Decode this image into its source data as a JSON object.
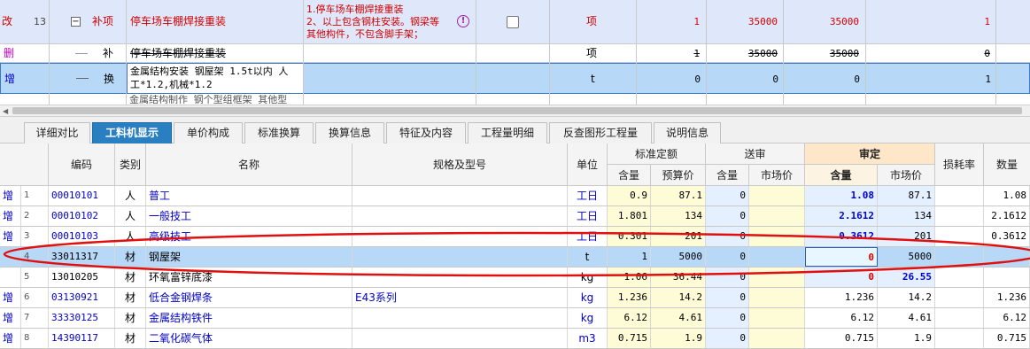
{
  "top_rows": [
    {
      "tag": "改",
      "num": "13",
      "toggle": "−",
      "kind": "补项",
      "name": "停车场车棚焊接重装",
      "feature_line1": "1.停车场车棚焊接重装",
      "feature_line2": "2、以上包含钢柱安装。钢梁等",
      "feature_line3": "其他构件，不包含脚手架；",
      "unit": "项",
      "qty": "1",
      "price": "35000",
      "price2": "35000",
      "last": "1"
    },
    {
      "tag": "删",
      "kind": "补",
      "name": "停车场车棚焊接重装",
      "unit": "项",
      "qty": "1",
      "price": "35000",
      "price2": "35000",
      "last": "0"
    },
    {
      "tag": "增",
      "kind": "换",
      "name_line1": "金属结构安装 钢屋架 1.5t以内  人",
      "name_line2": "工*1.2,机械*1.2",
      "unit": "t",
      "qty": "0",
      "price": "0",
      "price2": "0",
      "last": "1"
    },
    {
      "partial": "金属结构制作 钢个型组框架 其他型"
    }
  ],
  "tabs": [
    "详细对比",
    "工料机显示",
    "单价构成",
    "标准换算",
    "换算信息",
    "特征及内容",
    "工程量明细",
    "反查图形工程量",
    "说明信息"
  ],
  "active_tab": "工料机显示",
  "headers": {
    "code": "编码",
    "type": "类别",
    "name": "名称",
    "spec": "规格及型号",
    "unit": "单位",
    "std": "标准定额",
    "std_qty": "含量",
    "std_price": "预算价",
    "sub": "送审",
    "sub_qty": "含量",
    "sub_price": "市场价",
    "aud": "审定",
    "aud_qty": "含量",
    "aud_price": "市场价",
    "loss": "损耗率",
    "count": "数量"
  },
  "rows": [
    {
      "tag": "增",
      "n": "1",
      "code": "00010101",
      "type": "人",
      "name": "普工",
      "spec": "",
      "unit": "工日",
      "std_qty": "0.9",
      "std_price": "87.1",
      "sub_qty": "0",
      "sub_price": "",
      "aud_qty": "1.08",
      "aud_price": "87.1",
      "count": "1.08"
    },
    {
      "tag": "增",
      "n": "2",
      "code": "00010102",
      "type": "人",
      "name": "一般技工",
      "spec": "",
      "unit": "工日",
      "std_qty": "1.801",
      "std_price": "134",
      "sub_qty": "0",
      "sub_price": "",
      "aud_qty": "2.1612",
      "aud_price": "134",
      "count": "2.1612"
    },
    {
      "tag": "增",
      "n": "3",
      "code": "00010103",
      "type": "人",
      "name": "高级技工",
      "spec": "",
      "unit": "工日",
      "std_qty": "0.301",
      "std_price": "201",
      "sub_qty": "0",
      "sub_price": "",
      "aud_qty": "0.3612",
      "aud_price": "201",
      "count": "0.3612"
    },
    {
      "tag": "",
      "n": "4",
      "code": "33011317",
      "type": "材",
      "name": "钢屋架",
      "spec": "",
      "unit": "t",
      "std_qty": "1",
      "std_price": "5000",
      "sub_qty": "0",
      "sub_price": "",
      "aud_qty": "0",
      "aud_price": "5000",
      "count": ""
    },
    {
      "tag": "",
      "n": "5",
      "code": "13010205",
      "type": "材",
      "name": "环氧富锌底漆",
      "spec": "",
      "unit": "kg",
      "std_qty": "1.06",
      "std_price": "36.44",
      "sub_qty": "0",
      "sub_price": "",
      "aud_qty": "0",
      "aud_price": "26.55",
      "count": ""
    },
    {
      "tag": "增",
      "n": "6",
      "code": "03130921",
      "type": "材",
      "name": "低合金钢焊条",
      "spec": "E43系列",
      "unit": "kg",
      "std_qty": "1.236",
      "std_price": "14.2",
      "sub_qty": "0",
      "sub_price": "",
      "aud_qty": "1.236",
      "aud_price": "14.2",
      "count": "1.236"
    },
    {
      "tag": "增",
      "n": "7",
      "code": "33330125",
      "type": "材",
      "name": "金属结构铁件",
      "spec": "",
      "unit": "kg",
      "std_qty": "6.12",
      "std_price": "4.61",
      "sub_qty": "0",
      "sub_price": "",
      "aud_qty": "6.12",
      "aud_price": "4.61",
      "count": "6.12"
    },
    {
      "tag": "增",
      "n": "8",
      "code": "14390117",
      "type": "材",
      "name": "二氧化碳气体",
      "spec": "",
      "unit": "m3",
      "std_qty": "0.715",
      "std_price": "1.9",
      "sub_qty": "0",
      "sub_price": "",
      "aud_qty": "0.715",
      "aud_price": "1.9",
      "count": "0.715"
    }
  ],
  "colors": {
    "tab_active": "#2a7fc1",
    "selected_row": "#b8d8f8",
    "highlight_ellipse": "#e01010"
  }
}
